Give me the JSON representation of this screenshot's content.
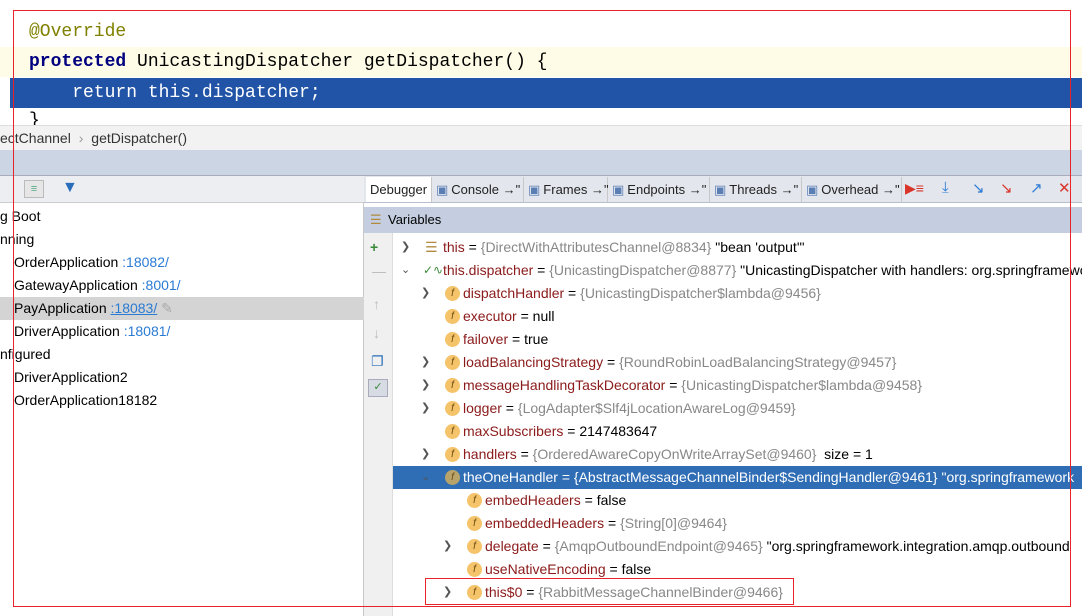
{
  "editor": {
    "lines": [
      {
        "annotation": "@Override"
      },
      {
        "keyword": "protected",
        "text": " UnicastingDispatcher getDispatcher() {"
      },
      {
        "text": "    return this.dispatcher;"
      },
      {
        "text": "}"
      }
    ]
  },
  "breadcrumb": {
    "class": "ectChannel",
    "separator": "›",
    "method": "getDispatcher()"
  },
  "services": {
    "items": [
      {
        "label": "g Boot"
      },
      {
        "label": "nning"
      },
      {
        "label": "OrderApplication",
        "port": ":18082/"
      },
      {
        "label": "GatewayApplication",
        "port": ":8001/"
      },
      {
        "label": "PayApplication",
        "port": ":18083/",
        "selected": true
      },
      {
        "label": "DriverApplication",
        "port": ":18081/"
      },
      {
        "label": "nfigured"
      },
      {
        "label": "DriverApplication2"
      },
      {
        "label": "OrderApplication18182"
      }
    ]
  },
  "debug": {
    "tabs": [
      {
        "label": "Debugger",
        "icon": "none"
      },
      {
        "label": "Console →\"",
        "icon": "console-icon"
      },
      {
        "label": "Frames →\"",
        "icon": "frames-icon"
      },
      {
        "label": "Endpoints →\"",
        "icon": "endpoints-icon"
      },
      {
        "label": "Threads →\"",
        "icon": "threads-icon"
      },
      {
        "label": "Overhead →\"",
        "icon": "overhead-icon"
      }
    ],
    "variables_title": "Variables",
    "variables": [
      {
        "depth": 0,
        "chev": ">",
        "icon": "list",
        "name": "this",
        "eq": " = ",
        "ref": "{DirectWithAttributesChannel@8834}",
        "extra": " \"bean 'output'\""
      },
      {
        "depth": 0,
        "chev": "v",
        "icon": "watch",
        "name": "this.dispatcher",
        "eq": " = ",
        "ref": "{UnicastingDispatcher@8877}",
        "extra": " \"UnicastingDispatcher with handlers: org.springframework"
      },
      {
        "depth": 1,
        "chev": ">",
        "icon": "f",
        "name": "dispatchHandler",
        "eq": " = ",
        "ref": "{UnicastingDispatcher$lambda@9456}"
      },
      {
        "depth": 1,
        "chev": "",
        "icon": "f",
        "name": "executor",
        "eq": " = ",
        "extra": "null"
      },
      {
        "depth": 1,
        "chev": "",
        "icon": "f",
        "name": "failover",
        "eq": " = ",
        "extra": "true"
      },
      {
        "depth": 1,
        "chev": ">",
        "icon": "f",
        "name": "loadBalancingStrategy",
        "eq": " = ",
        "ref": "{RoundRobinLoadBalancingStrategy@9457}"
      },
      {
        "depth": 1,
        "chev": ">",
        "icon": "f",
        "name": "messageHandlingTaskDecorator",
        "eq": " = ",
        "ref": "{UnicastingDispatcher$lambda@9458}"
      },
      {
        "depth": 1,
        "chev": ">",
        "icon": "f",
        "name": "logger",
        "eq": " = ",
        "ref": "{LogAdapter$Slf4jLocationAwareLog@9459}"
      },
      {
        "depth": 1,
        "chev": "",
        "icon": "f",
        "name": "maxSubscribers",
        "eq": " = ",
        "extra": "2147483647"
      },
      {
        "depth": 1,
        "chev": ">",
        "icon": "f",
        "name": "handlers",
        "eq": " = ",
        "ref": "{OrderedAwareCopyOnWriteArraySet@9460}",
        "extra": "  size = 1"
      },
      {
        "depth": 1,
        "chev": "v",
        "icon": "f",
        "name": "theOneHandler",
        "eq": " = ",
        "ref": "{AbstractMessageChannelBinder$SendingHandler@9461}",
        "extra": " \"org.springframework",
        "selected": true
      },
      {
        "depth": 2,
        "chev": "",
        "icon": "f",
        "name": "embedHeaders",
        "eq": " = ",
        "extra": "false"
      },
      {
        "depth": 2,
        "chev": "",
        "icon": "f",
        "name": "embeddedHeaders",
        "eq": " = ",
        "ref": "{String[0]@9464}"
      },
      {
        "depth": 2,
        "chev": ">",
        "icon": "f",
        "name": "delegate",
        "eq": " = ",
        "ref": "{AmqpOutboundEndpoint@9465}",
        "extra": " \"org.springframework.integration.amqp.outbound"
      },
      {
        "depth": 2,
        "chev": "",
        "icon": "f",
        "name": "useNativeEncoding",
        "eq": " = ",
        "extra": "false"
      },
      {
        "depth": 2,
        "chev": ">",
        "icon": "f",
        "name": "this$0",
        "eq": " = ",
        "ref": "{RabbitMessageChannelBinder@9466}",
        "highlighted": true
      }
    ]
  },
  "colors": {
    "selection": "#2f6db5",
    "current_line": "#2154a6",
    "highlight_box": "#e8242a"
  }
}
